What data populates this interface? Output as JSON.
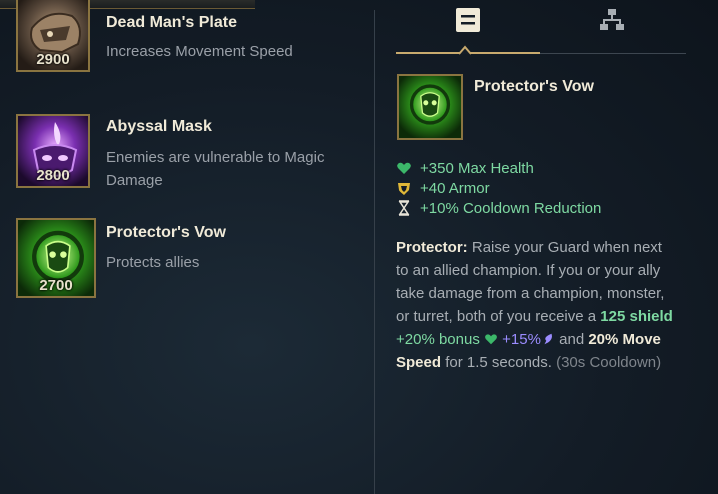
{
  "items": [
    {
      "name": "Dead Man's Plate",
      "description": "Increases Movement Speed",
      "price": "2900"
    },
    {
      "name": "Abyssal Mask",
      "description": "Enemies are vulnerable to Magic Damage",
      "price": "2800"
    },
    {
      "name": "Protector's Vow",
      "description": "Protects allies",
      "price": "2700"
    }
  ],
  "tabs": [
    {
      "icon": "list-icon",
      "selected": true
    },
    {
      "icon": "build-tree-icon",
      "selected": false
    }
  ],
  "detail": {
    "title": "Protector's Vow",
    "stats": [
      {
        "icon": "heart-icon",
        "text": "+350 Max Health"
      },
      {
        "icon": "armor-icon",
        "text": "+40 Armor"
      },
      {
        "icon": "hourglass-icon",
        "text": "+10% Cooldown Reduction"
      }
    ],
    "passive": {
      "name": "Protector:",
      "text1": "Raise your Guard when next to an allied champion. If you or your ally take damage from a champion, monster, or turret, both of you receive a",
      "shield": "125 shield",
      "bonus": "+20% bonus",
      "ap": "+15%",
      "and": "and",
      "move": "20% Move Speed",
      "duration": "for 1.5 seconds.",
      "cooldown": "(30s Cooldown)"
    }
  },
  "colors": {
    "stat_green": "#7ed9a2",
    "gold_border": "#8a7440",
    "ap_purple": "#9b8cff"
  }
}
